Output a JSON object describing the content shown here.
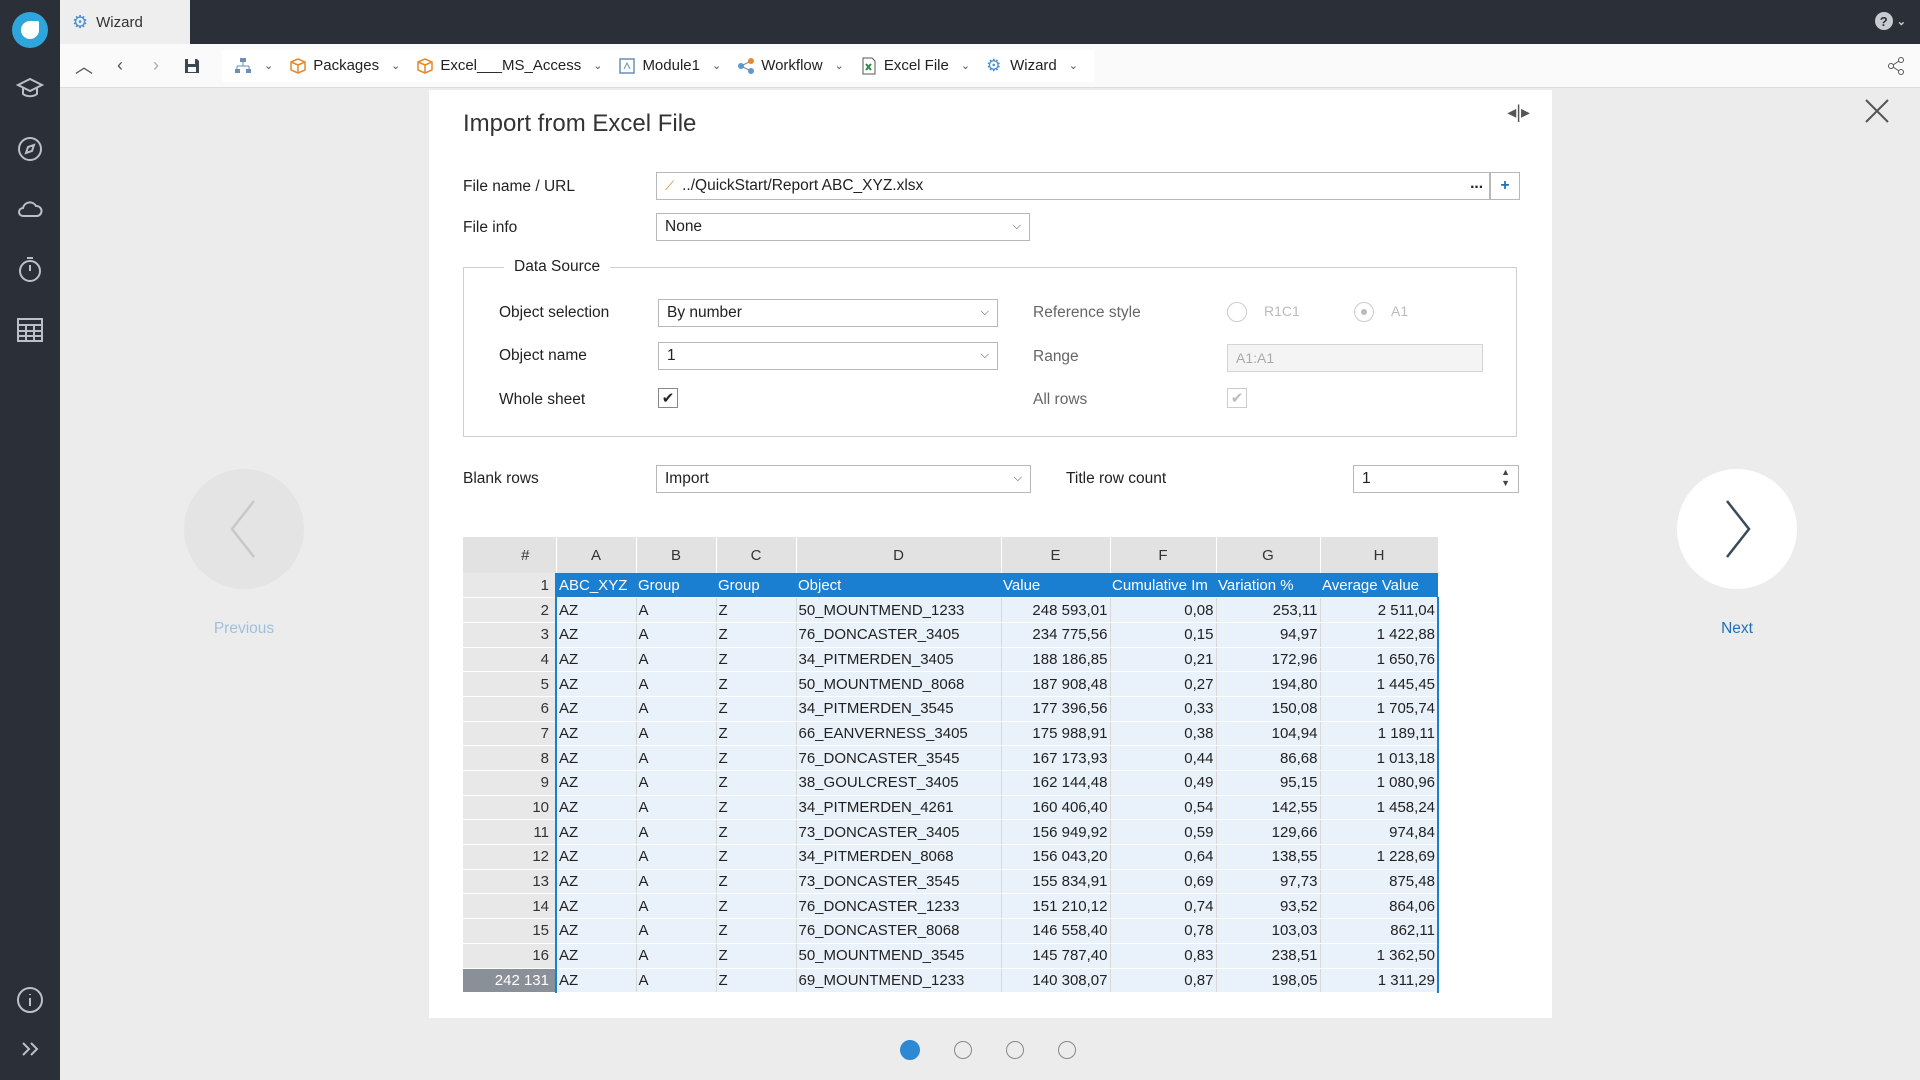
{
  "window": {
    "tab_title": "Wizard"
  },
  "breadcrumbs": [
    {
      "label": "",
      "icon": "tree-icon"
    },
    {
      "label": "Packages",
      "icon": "package-icon"
    },
    {
      "label": "Excel___MS_Access",
      "icon": "package-icon"
    },
    {
      "label": "Module1",
      "icon": "module-icon"
    },
    {
      "label": "Workflow",
      "icon": "workflow-icon"
    },
    {
      "label": "Excel File",
      "icon": "excel-icon"
    },
    {
      "label": "Wizard",
      "icon": "gear-icon"
    }
  ],
  "dialog": {
    "title": "Import from Excel File",
    "file_name_label": "File name / URL",
    "file_name_value": "../QuickStart/Report ABC_XYZ.xlsx",
    "browse_label": "...",
    "add_label": "+",
    "file_info_label": "File info",
    "file_info_value": "None",
    "data_source_legend": "Data Source",
    "object_selection_label": "Object selection",
    "object_selection_value": "By number",
    "object_name_label": "Object name",
    "object_name_value": "1",
    "whole_sheet_label": "Whole sheet",
    "whole_sheet_checked": true,
    "reference_style_label": "Reference style",
    "r1c1_label": "R1C1",
    "a1_label": "A1",
    "range_label": "Range",
    "range_value": "A1:A1",
    "all_rows_label": "All rows",
    "blank_rows_label": "Blank rows",
    "blank_rows_value": "Import",
    "title_row_count_label": "Title row count",
    "title_row_count_value": "1"
  },
  "grid": {
    "corner": "#",
    "columns": [
      "A",
      "B",
      "C",
      "D",
      "E",
      "F",
      "G",
      "H"
    ],
    "header_row": {
      "n": "1",
      "cells": [
        "ABC_XYZ",
        "Group",
        "Group",
        "Object",
        "Value",
        "Cumulative Im",
        "Variation %",
        "Average Value"
      ]
    },
    "rows": [
      {
        "n": "2",
        "cells": [
          "AZ",
          "A",
          "Z",
          "50_MOUNTMEND_1233",
          "248 593,01",
          "0,08",
          "253,11",
          "2 511,04"
        ]
      },
      {
        "n": "3",
        "cells": [
          "AZ",
          "A",
          "Z",
          "76_DONCASTER_3405",
          "234 775,56",
          "0,15",
          "94,97",
          "1 422,88"
        ]
      },
      {
        "n": "4",
        "cells": [
          "AZ",
          "A",
          "Z",
          "34_PITMERDEN_3405",
          "188 186,85",
          "0,21",
          "172,96",
          "1 650,76"
        ]
      },
      {
        "n": "5",
        "cells": [
          "AZ",
          "A",
          "Z",
          "50_MOUNTMEND_8068",
          "187 908,48",
          "0,27",
          "194,80",
          "1 445,45"
        ]
      },
      {
        "n": "6",
        "cells": [
          "AZ",
          "A",
          "Z",
          "34_PITMERDEN_3545",
          "177 396,56",
          "0,33",
          "150,08",
          "1 705,74"
        ]
      },
      {
        "n": "7",
        "cells": [
          "AZ",
          "A",
          "Z",
          "66_EANVERNESS_3405",
          "175 988,91",
          "0,38",
          "104,94",
          "1 189,11"
        ]
      },
      {
        "n": "8",
        "cells": [
          "AZ",
          "A",
          "Z",
          "76_DONCASTER_3545",
          "167 173,93",
          "0,44",
          "86,68",
          "1 013,18"
        ]
      },
      {
        "n": "9",
        "cells": [
          "AZ",
          "A",
          "Z",
          "38_GOULCREST_3405",
          "162 144,48",
          "0,49",
          "95,15",
          "1 080,96"
        ]
      },
      {
        "n": "10",
        "cells": [
          "AZ",
          "A",
          "Z",
          "34_PITMERDEN_4261",
          "160 406,40",
          "0,54",
          "142,55",
          "1 458,24"
        ]
      },
      {
        "n": "11",
        "cells": [
          "AZ",
          "A",
          "Z",
          "73_DONCASTER_3405",
          "156 949,92",
          "0,59",
          "129,66",
          "974,84"
        ]
      },
      {
        "n": "12",
        "cells": [
          "AZ",
          "A",
          "Z",
          "34_PITMERDEN_8068",
          "156 043,20",
          "0,64",
          "138,55",
          "1 228,69"
        ]
      },
      {
        "n": "13",
        "cells": [
          "AZ",
          "A",
          "Z",
          "73_DONCASTER_3545",
          "155 834,91",
          "0,69",
          "97,73",
          "875,48"
        ]
      },
      {
        "n": "14",
        "cells": [
          "AZ",
          "A",
          "Z",
          "76_DONCASTER_1233",
          "151 210,12",
          "0,74",
          "93,52",
          "864,06"
        ]
      },
      {
        "n": "15",
        "cells": [
          "AZ",
          "A",
          "Z",
          "76_DONCASTER_8068",
          "146 558,40",
          "0,78",
          "103,03",
          "862,11"
        ]
      },
      {
        "n": "16",
        "cells": [
          "AZ",
          "A",
          "Z",
          "50_MOUNTMEND_3545",
          "145 787,40",
          "0,83",
          "238,51",
          "1 362,50"
        ]
      },
      {
        "n": "242 131",
        "cells": [
          "AZ",
          "A",
          "Z",
          "69_MOUNTMEND_1233",
          "140 308,07",
          "0,87",
          "198,05",
          "1 311,29"
        ]
      }
    ]
  },
  "navigation": {
    "previous_label": "Previous",
    "next_label": "Next",
    "steps_total": 4,
    "current_step": 1
  },
  "colors": {
    "accent": "#1a7fd0",
    "rail": "#2b3038",
    "link": "#1f6fb5"
  }
}
